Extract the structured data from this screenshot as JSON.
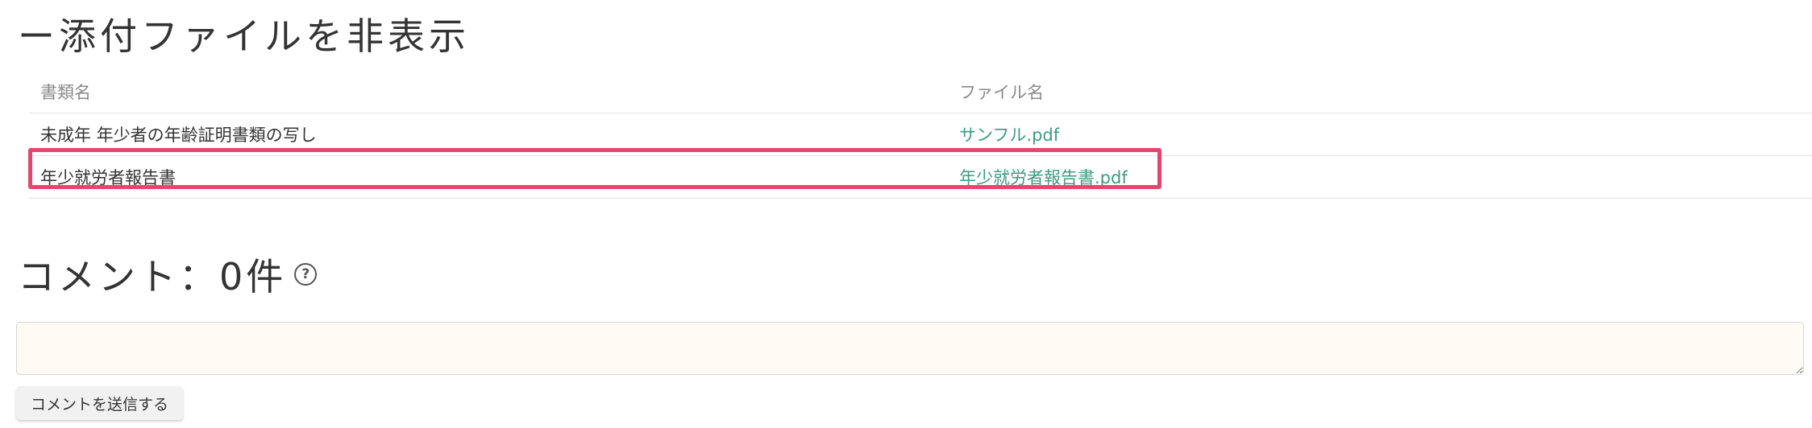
{
  "attachments": {
    "toggle_title": "ー添付ファイルを非表示",
    "columns": {
      "document_name": "書類名",
      "file_name": "ファイル名"
    },
    "rows": [
      {
        "document_name": "未成年 年少者の年齢証明書類の写し",
        "file_name": "サンフル.pdf"
      },
      {
        "document_name": "年少就労者報告書",
        "file_name": "年少就労者報告書.pdf"
      }
    ],
    "highlighted_row_index": 1,
    "highlight_color": "#e5466e",
    "link_color": "#3f9a83"
  },
  "comments": {
    "title": "コメント：0件",
    "help_icon": "question-circle-icon",
    "help_glyph": "?",
    "input_value": "",
    "input_background": "#fffaf3",
    "submit_label": "コメントを送信する"
  }
}
